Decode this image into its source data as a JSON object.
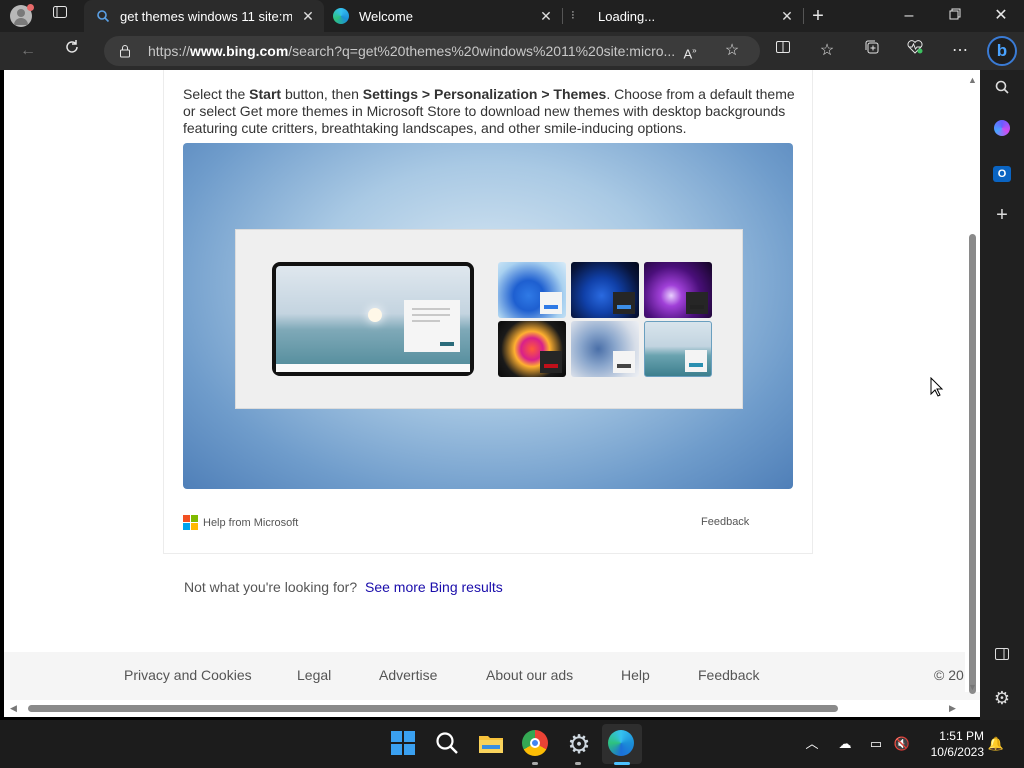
{
  "browser": {
    "tabs": [
      {
        "label": "get themes windows 11 site:micr",
        "active": true
      },
      {
        "label": "Welcome",
        "active": false
      },
      {
        "label": "Loading...",
        "active": false
      }
    ],
    "url_prefix": "https://",
    "url_domain": "www.bing.com",
    "url_rest": "/search?q=get%20themes%20windows%2011%20site:micro..."
  },
  "content": {
    "desc_pre": "Select the ",
    "desc_start": "Start",
    "desc_mid": " button, then ",
    "desc_path": "Settings > Personalization > Themes",
    "desc_post": ". Choose from a default theme or select Get more themes in Microsoft Store to download new themes with desktop backgrounds featuring cute critters, breathtaking landscapes, and other smile-inducing options.",
    "help_from": "Help from Microsoft",
    "feedback": "Feedback",
    "not_what": "Not what you're looking for?",
    "see_more": "See more Bing results"
  },
  "footer": {
    "links": [
      "Privacy and Cookies",
      "Legal",
      "Advertise",
      "About our ads",
      "Help",
      "Feedback"
    ],
    "copyright": "© 20"
  },
  "taskbar": {
    "time": "1:51 PM",
    "date": "10/6/2023"
  },
  "colors": {
    "link": "#1a0dab",
    "accent": "#0078d4"
  }
}
